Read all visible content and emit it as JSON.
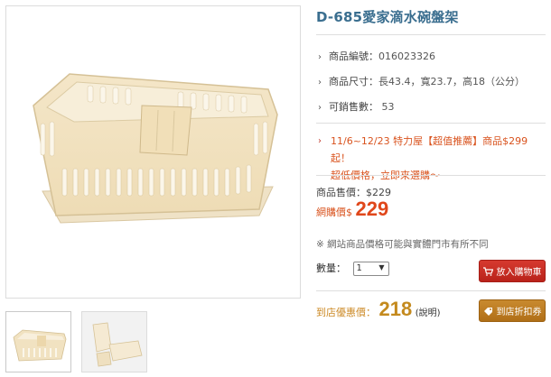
{
  "product": {
    "title": "D-685愛家滴水碗盤架",
    "specs": [
      {
        "label": "商品編號：",
        "value": "016023326"
      },
      {
        "label": "商品尺寸：",
        "value": "長43.4，寬23.7，高18（公分）"
      },
      {
        "label": "可銷售數：",
        "value": "53"
      }
    ],
    "promo_line1": "11/6~12/23 特力屋【超值推薦】商品$299起！",
    "promo_line2": "超低價格，立即來選購～"
  },
  "pricing": {
    "list_label": "商品售價：",
    "list_value": "$229",
    "net_label": "網購價$",
    "net_value": "229",
    "notice": "※ 網站商品價格可能與實體門市有所不同",
    "store_label": "到店優惠價：",
    "store_value": "218",
    "store_note": "(說明)"
  },
  "purchase": {
    "qty_label": "數量：",
    "qty_value": "1",
    "cart_button": "放入購物車",
    "coupon_button": "到店折扣券"
  },
  "colors": {
    "title": "#3a6e8f",
    "promo": "#d9531e",
    "net_price": "#e0471b",
    "cart_button": "#c8281f",
    "coupon_button": "#bd7b22",
    "store_price": "#c48a1e"
  }
}
